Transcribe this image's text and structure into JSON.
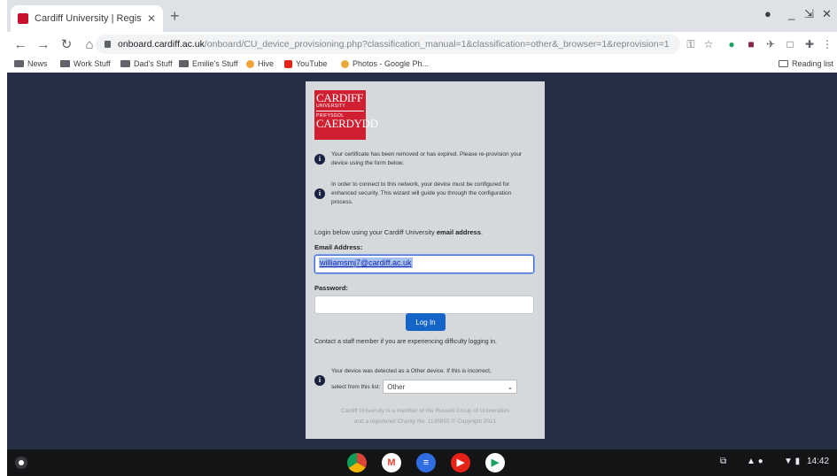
{
  "tab": {
    "title": "Cardiff University | Register You",
    "close_icon": "close-icon",
    "new_tab_icon": "plus-icon"
  },
  "toolbar": {
    "url_host": "onboard.cardiff.ac.uk",
    "url_path": "/onboard/CU_device_provisioning.php?classification_manual=1&classification=other&_browser=1&reprovision=1"
  },
  "bookmarks": [
    {
      "label": "News",
      "icon": "folder-icon"
    },
    {
      "label": "Work Stuff",
      "icon": "folder-icon"
    },
    {
      "label": "Dad's Stuff",
      "icon": "folder-icon"
    },
    {
      "label": "Emilie's Stuff",
      "icon": "folder-icon"
    },
    {
      "label": "Hive",
      "icon": "hive-icon",
      "color": "#f2a33a"
    },
    {
      "label": "YouTube",
      "icon": "youtube-icon",
      "color": "#e62117"
    },
    {
      "label": "Photos - Google Ph...",
      "icon": "photos-icon",
      "color": "#e9a93a"
    }
  ],
  "reading_list": "Reading list",
  "logo": {
    "line1": "CARDIFF",
    "line2": "UNIVERSITY",
    "line3": "PRIFYSGOL",
    "line4": "CAERDYDD"
  },
  "card": {
    "info1": "Your certificate has been removed or has expired. Please re-provision your device using the form below.",
    "info2": "In order to connect to this network, your device must be configured for enhanced security. This wizard will guide you through the configuration process.",
    "login_prefix": "Login below using your Cardiff University ",
    "login_bold": "email address",
    "login_suffix": ".",
    "email_label": "Email Address:",
    "email_value": "williamsmj7@cardiff.ac.uk",
    "password_label": "Password:",
    "login_button": "Log In",
    "contact": "Contact a staff member if you are experiencing difficulty logging in.",
    "detect": "Your device was detected as a Other device. If this is incorrect,",
    "select_prefix": "select from this list:",
    "device_selected": "Other",
    "footer_line1": "Cardiff University is a member of the Russell Group of Universities",
    "footer_line2": "and a registered Charity No. 1136855 © Copyright 2021"
  },
  "shelf": {
    "apps": [
      {
        "name": "chrome",
        "color": "#d8442f"
      },
      {
        "name": "gmail",
        "color": "#ea4335"
      },
      {
        "name": "docs",
        "color": "#2f6de1"
      },
      {
        "name": "youtube",
        "color": "#e62117"
      },
      {
        "name": "play",
        "color": "#1aa260"
      }
    ],
    "time": "14:42"
  }
}
